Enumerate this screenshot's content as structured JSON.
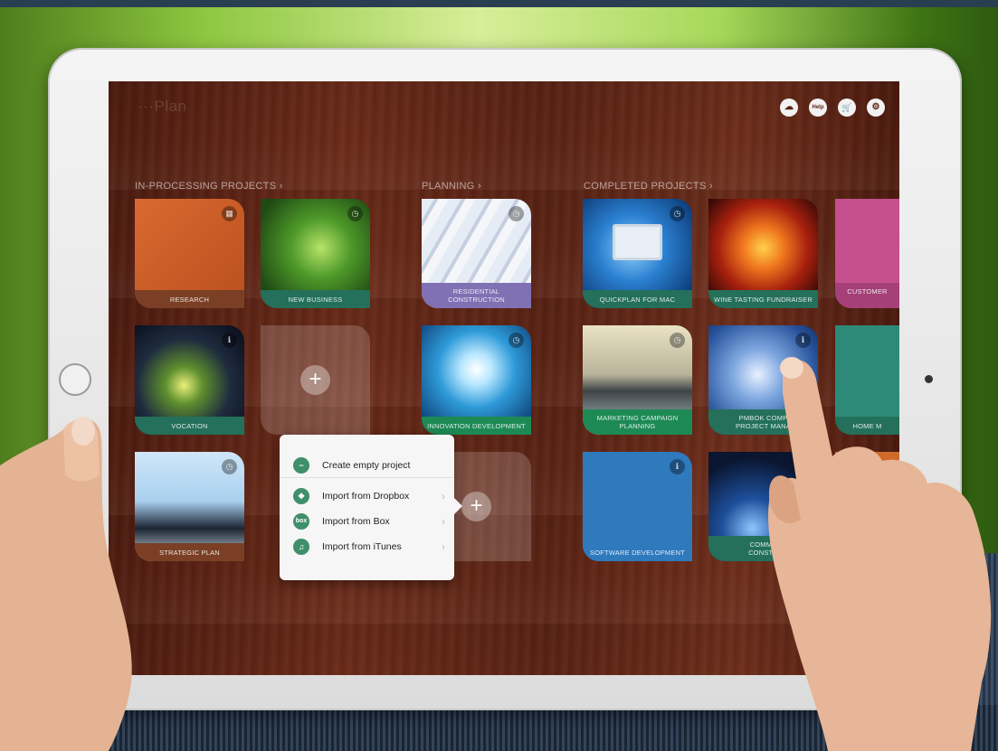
{
  "app": {
    "logo": "···Plan"
  },
  "top_actions": [
    {
      "name": "cloud-icon",
      "glyph": "☁"
    },
    {
      "name": "help-icon",
      "glyph": "Help"
    },
    {
      "name": "cart-icon",
      "glyph": "🛒"
    },
    {
      "name": "gear-icon",
      "glyph": "⚙"
    }
  ],
  "sections": {
    "in_processing": "IN-PROCESSING PROJECTS ›",
    "planning": "PLANNING ›",
    "completed": "COMPLETED PROJECTS ›"
  },
  "tiles": {
    "research": "RESEARCH",
    "new_business": "NEW BUSINESS",
    "residential": "RESIDENTIAL\nCONSTRUCTION",
    "quickplan_mac": "QUICKPLAN FOR MAC",
    "wine_tasting": "WINE TASTING FUNDRAISER",
    "customer": "CUSTOMER",
    "vocation": "VOCATION",
    "innovation": "INNOVATION DEVELOPMENT",
    "marketing": "MARKETING CAMPAIGN\nPLANNING",
    "pmbok": "PMBOK COMP\nPROJECT MANA",
    "home": "HOME M",
    "strategic": "STRATEGIC PLAN",
    "software": "SOFTWARE DEVELOPMENT",
    "commercial": "COMME\nCONSTR"
  },
  "popover": {
    "create_empty": "Create empty project",
    "import_dropbox": "Import from Dropbox",
    "import_box": "Import from Box",
    "import_itunes": "Import from iTunes",
    "box_glyph": "box"
  },
  "colors": {
    "wood": "#5e2516",
    "accent_green": "#3e8f6a",
    "research_orange": "#c85a28",
    "software_blue": "#2f79bd",
    "customer_pink": "#c4508f"
  }
}
